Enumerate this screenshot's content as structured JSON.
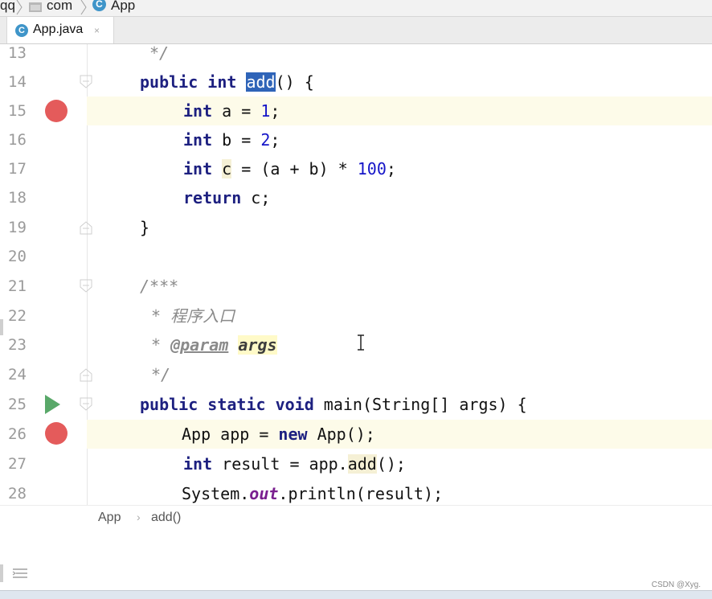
{
  "navbar": {
    "crumbs": [
      "qq",
      "com",
      "App"
    ]
  },
  "tab": {
    "label": "App.java",
    "icon": "class-c-icon",
    "close": "×"
  },
  "editor": {
    "lines": [
      {
        "n": "13"
      },
      {
        "n": "14"
      },
      {
        "n": "15"
      },
      {
        "n": "16"
      },
      {
        "n": "17"
      },
      {
        "n": "18"
      },
      {
        "n": "19"
      },
      {
        "n": "20"
      },
      {
        "n": "21"
      },
      {
        "n": "22"
      },
      {
        "n": "23"
      },
      {
        "n": "24"
      },
      {
        "n": "25"
      },
      {
        "n": "26"
      },
      {
        "n": "27"
      },
      {
        "n": "28"
      }
    ],
    "tokens": {
      "l13_cmt": "*/",
      "l14_kw1": "public",
      "l14_kw2": "int",
      "l14_name": "add",
      "l14_rest": "() {",
      "l15_kw": "int",
      "l15_mid": " a = ",
      "l15_num": "1",
      "l15_end": ";",
      "l16_kw": "int",
      "l16_mid": " b = ",
      "l16_num": "2",
      "l16_end": ";",
      "l17_kw": "int",
      "l17_var": "c",
      "l17_mid": " = (a + b) * ",
      "l17_num": "100",
      "l17_end": ";",
      "l18_kw": "return",
      "l18_rest": " c;",
      "l19_brace": "}",
      "l21_cmt": "/***",
      "l22_cmt": "* 程序入口",
      "l23_star": "* ",
      "l23_tag": "@param",
      "l23_arg": "args",
      "l24_cmt": "*/",
      "l25_kw1": "public",
      "l25_kw2": "static",
      "l25_kw3": "void",
      "l25_rest": " main(String[] args) {",
      "l26_a": "App app = ",
      "l26_kw": "new",
      "l26_b": " App();",
      "l27_kw": "int",
      "l27_a": " result = app.",
      "l27_m": "add",
      "l27_b": "();",
      "l28_a": "System.",
      "l28_field": "out",
      "l28_b": ".println(result);"
    },
    "breakpoints": [
      "15",
      "26"
    ],
    "run_gutter_line": "25",
    "selected_symbol": "add"
  },
  "breadcrumb": {
    "items": [
      "App",
      "add()"
    ],
    "separator": "›"
  },
  "watermark": "CSDN @Xyg.",
  "colors": {
    "keyword": "#1d2080",
    "number": "#1515c8",
    "comment": "#8a8a8a",
    "breakpoint": "#e45b5b",
    "run": "#59a869",
    "selection": "#2f64b8"
  }
}
